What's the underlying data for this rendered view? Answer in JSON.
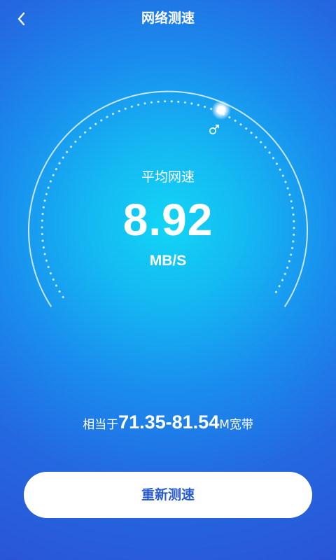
{
  "header": {
    "back_icon": "chevron-left-icon",
    "title": "网络测速"
  },
  "gauge": {
    "label": "平均网速",
    "value": "8.92",
    "unit": "MB/S",
    "indicator_icon": "gender-male-icon"
  },
  "equivalent": {
    "prefix": "相当于",
    "range": "71.35-81.54",
    "suffix": "M宽带"
  },
  "actions": {
    "retest_label": "重新测速"
  },
  "colors": {
    "background_center": "#12d6f5",
    "background_edge": "#2a55d6",
    "button_bg": "#ffffff",
    "button_text": "#2a5bd7",
    "text": "#ffffff"
  }
}
